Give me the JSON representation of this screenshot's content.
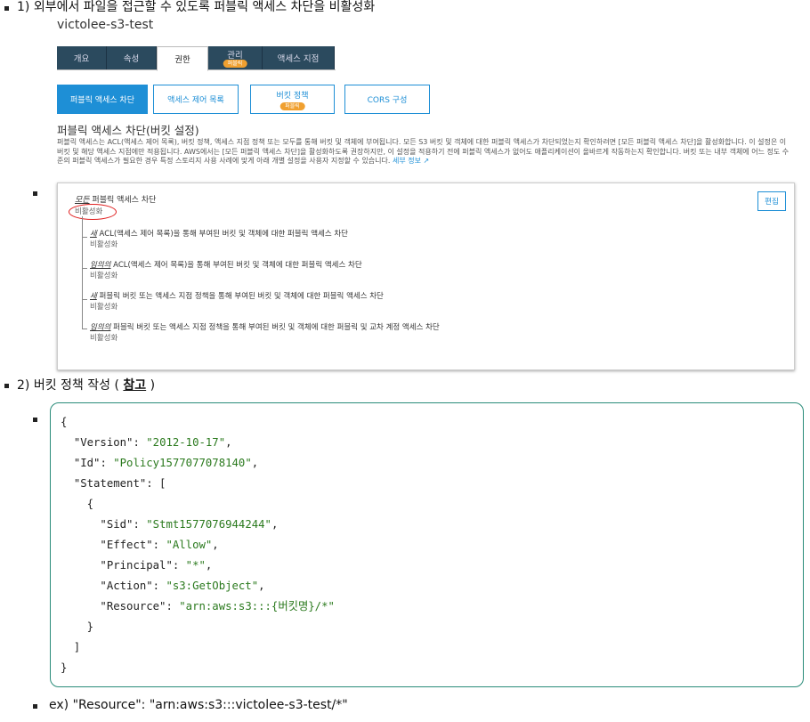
{
  "item1": {
    "text": "1) 외부에서 파일을 접근할 수 있도록 퍼블릭 액세스 차단을 비활성화"
  },
  "s3": {
    "bucket_title": "victolee-s3-test",
    "tabs": [
      {
        "label": "개요"
      },
      {
        "label": "속성"
      },
      {
        "label": "권한",
        "active": true
      },
      {
        "label": "관리",
        "badge": "퍼블릭"
      },
      {
        "label": "액세스 지점"
      }
    ],
    "subtabs": [
      {
        "label": "퍼블릭 액세스 차단",
        "active": true
      },
      {
        "label": "액세스 제어 목록"
      },
      {
        "label": "버킷 정책",
        "badge": "퍼블릭"
      },
      {
        "label": "CORS 구성"
      }
    ],
    "section_title": "퍼블릭 액세스 차단(버킷 설정)",
    "description": "퍼블릭 액세스는 ACL(액세스 제어 목록), 버킷 정책, 액세스 지점 정책 또는 모두를 통해 버킷 및 객체에 부여됩니다. 모든 S3 버킷 및 객체에 대한 퍼블릭 액세스가 차단되었는지 확인하려면 [모든 퍼블릭 액세스 차단]을 활성화합니다. 이 설정은 이 버킷 및 해당 액세스 지점에만 적용됩니다. AWS에서는 [모든 퍼블릭 액세스 차단]을 활성화하도록 권장하지만, 이 설정을 적용하기 전에 퍼블릭 액세스가 없어도 애플리케이션이 올바르게 작동하는지 확인합니다. 버킷 또는 내부 객체에 어느 정도 수준의 퍼블릭 액세스가 필요한 경우 특정 스토리지 사용 사례에 맞게 아래 개별 설정을 사용자 지정할 수 있습니다.",
    "learn_more": "세부 정보",
    "panel": {
      "edit_label": "편집",
      "main_emph": "모든",
      "main_rest": " 퍼블릭 액세스 차단",
      "main_status": "비활성화",
      "items": [
        {
          "emph": "새",
          "rest": " ACL(액세스 제어 목록)을 통해 부여된 버킷 및 객체에 대한 퍼블릭 액세스 차단",
          "status": "비활성화"
        },
        {
          "emph": "임의의",
          "rest": " ACL(액세스 제어 목록)을 통해 부여된 버킷 및 객체에 대한 퍼블릭 액세스 차단",
          "status": "비활성화"
        },
        {
          "emph": "새",
          "rest": " 퍼블릭 버킷 또는 액세스 지점 정책을 통해 부여된 버킷 및 객체에 대한 퍼블릭 액세스 차단",
          "status": "비활성화"
        },
        {
          "emph": "임의의",
          "rest": " 퍼블릭 버킷 또는 액세스 지점 정책을 통해 부여된 버킷 및 객체에 대한 퍼블릭 및 교차 계정 액세스 차단",
          "status": "비활성화"
        }
      ]
    }
  },
  "item2": {
    "prefix": "2) 버킷 정책 작성 ( ",
    "link": "참고",
    "suffix": " )"
  },
  "code": {
    "open": "{",
    "version_key": "\"Version\"",
    "version_val": "\"2012-10-17\"",
    "id_key": "\"Id\"",
    "id_val": "\"Policy1577077078140\"",
    "statement_key": "\"Statement\"",
    "sid_key": "\"Sid\"",
    "sid_val": "\"Stmt1577076944244\"",
    "effect_key": "\"Effect\"",
    "effect_val": "\"Allow\"",
    "principal_key": "\"Principal\"",
    "principal_val": "\"*\"",
    "action_key": "\"Action\"",
    "action_val": "\"s3:GetObject\"",
    "resource_key": "\"Resource\"",
    "resource_val": "\"arn:aws:s3:::{버킷명}/*\"",
    "close": "}"
  },
  "item3": {
    "text": "ex) \"Resource\": \"arn:aws:s3:::victolee-s3-test/*\""
  }
}
